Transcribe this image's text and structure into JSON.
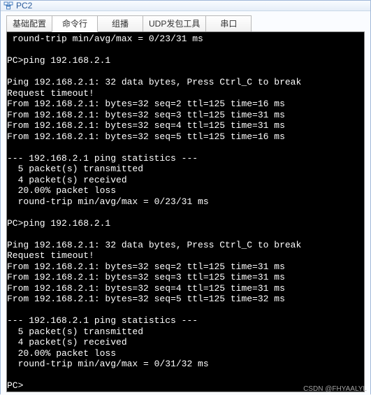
{
  "window": {
    "title": "PC2"
  },
  "tabs": {
    "items": [
      {
        "label": "基础配置",
        "active": false
      },
      {
        "label": "命令行",
        "active": true
      },
      {
        "label": "组播",
        "active": false
      },
      {
        "label": "UDP发包工具",
        "active": false
      },
      {
        "label": "串口",
        "active": false
      }
    ]
  },
  "terminal": {
    "lines": [
      " round-trip min/avg/max = 0/23/31 ms",
      "",
      "PC>ping 192.168.2.1",
      "",
      "Ping 192.168.2.1: 32 data bytes, Press Ctrl_C to break",
      "Request timeout!",
      "From 192.168.2.1: bytes=32 seq=2 ttl=125 time=16 ms",
      "From 192.168.2.1: bytes=32 seq=3 ttl=125 time=31 ms",
      "From 192.168.2.1: bytes=32 seq=4 ttl=125 time=31 ms",
      "From 192.168.2.1: bytes=32 seq=5 ttl=125 time=16 ms",
      "",
      "--- 192.168.2.1 ping statistics ---",
      "  5 packet(s) transmitted",
      "  4 packet(s) received",
      "  20.00% packet loss",
      "  round-trip min/avg/max = 0/23/31 ms",
      "",
      "PC>ping 192.168.2.1",
      "",
      "Ping 192.168.2.1: 32 data bytes, Press Ctrl_C to break",
      "Request timeout!",
      "From 192.168.2.1: bytes=32 seq=2 ttl=125 time=31 ms",
      "From 192.168.2.1: bytes=32 seq=3 ttl=125 time=31 ms",
      "From 192.168.2.1: bytes=32 seq=4 ttl=125 time=31 ms",
      "From 192.168.2.1: bytes=32 seq=5 ttl=125 time=32 ms",
      "",
      "--- 192.168.2.1 ping statistics ---",
      "  5 packet(s) transmitted",
      "  4 packet(s) received",
      "  20.00% packet loss",
      "  round-trip min/avg/max = 0/31/32 ms",
      "",
      "PC>"
    ]
  },
  "watermark": "CSDN @FHYAALYL"
}
